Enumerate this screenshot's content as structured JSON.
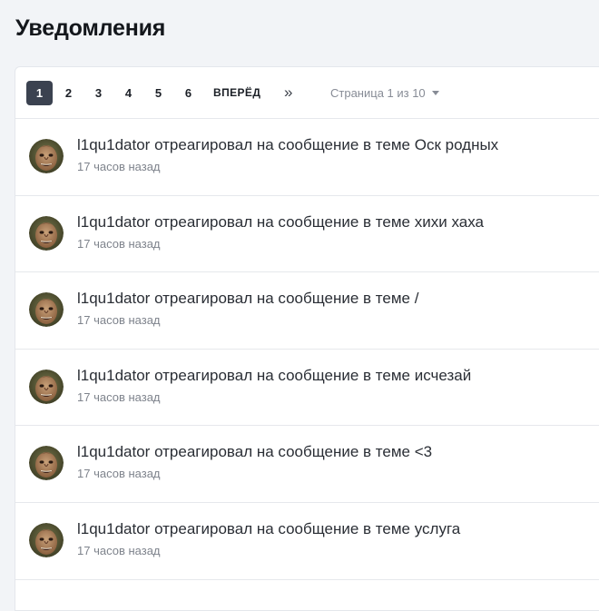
{
  "title": "Уведомления",
  "pagination": {
    "pages": [
      "1",
      "2",
      "3",
      "4",
      "5",
      "6"
    ],
    "current": "1",
    "next_label": "ВПЕРЁД",
    "last_label": "»",
    "page_info": "Страница 1 из 10"
  },
  "notifications": [
    {
      "text": "l1qu1dator отреагировал на сообщение в теме Оск родных",
      "time": "17 часов назад"
    },
    {
      "text": "l1qu1dator отреагировал на сообщение в теме хихи хаха",
      "time": "17 часов назад"
    },
    {
      "text": "l1qu1dator отреагировал на сообщение в теме /",
      "time": "17 часов назад"
    },
    {
      "text": "l1qu1dator отреагировал на сообщение в теме исчезай",
      "time": "17 часов назад"
    },
    {
      "text": "l1qu1dator отреагировал на сообщение в теме <3",
      "time": "17 часов назад"
    },
    {
      "text": "l1qu1dator отреагировал на сообщение в теме услуга",
      "time": "17 часов назад"
    }
  ],
  "icons": {
    "avatar": "face-avatar-icon",
    "page_menu": "caret-down-icon"
  }
}
